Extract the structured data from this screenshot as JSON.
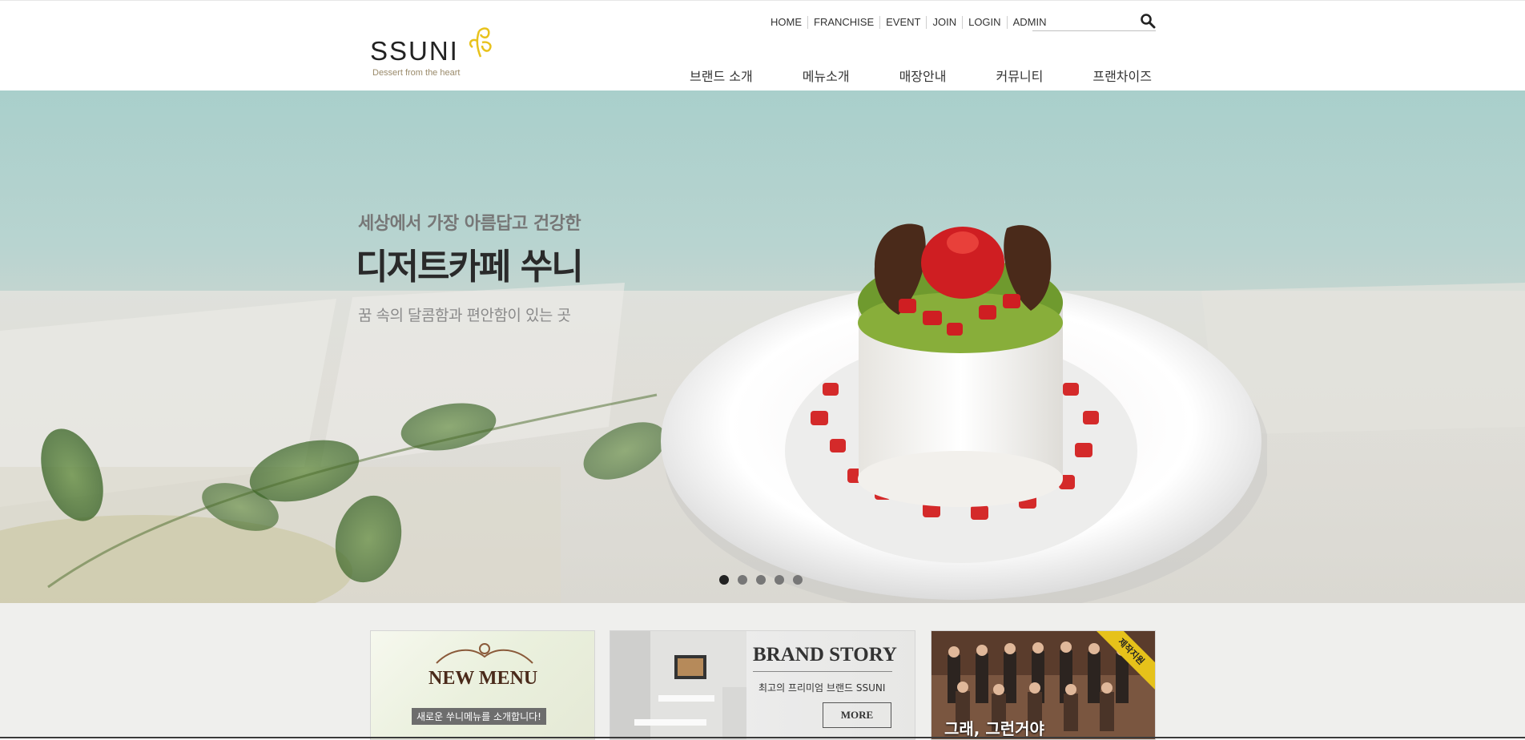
{
  "logo": {
    "text": "SSUNI",
    "tagline": "Dessert from the heart",
    "accent_color": "#e8c21c"
  },
  "util_nav": {
    "items": [
      "HOME",
      "FRANCHISE",
      "EVENT",
      "JOIN",
      "LOGIN",
      "ADMIN"
    ]
  },
  "search": {
    "placeholder": "",
    "icon": "search-icon"
  },
  "gnb": {
    "items": [
      "브랜드 소개",
      "메뉴소개",
      "매장안내",
      "커뮤니티",
      "프랜차이즈"
    ]
  },
  "hero": {
    "subtitle": "세상에서 가장 아름답고 건강한",
    "title": "디저트카페 쑤니",
    "description": "꿈 속의 달콤함과 편안함이 있는 곳",
    "slides": 5,
    "active_slide": 1
  },
  "cards": {
    "new_menu": {
      "title": "NEW MENU",
      "caption": "새로운 쑤니메뉴를 소개합니다!"
    },
    "brand_story": {
      "title": "BRAND STORY",
      "subtitle": "최고의 프리미엄 브랜드 SSUNI",
      "more_label": "MORE"
    },
    "drama": {
      "title": "그래, 그런거야",
      "ribbon": "제작지원"
    }
  }
}
